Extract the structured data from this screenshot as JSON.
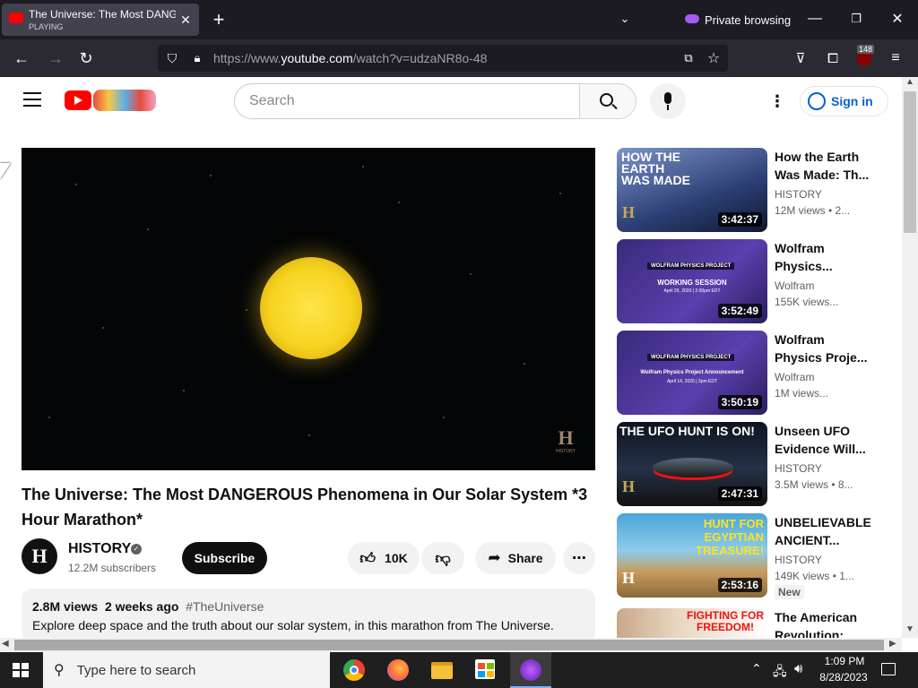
{
  "browser": {
    "tab_title": "The Universe: The Most DANGEROUS",
    "tab_status": "PLAYING",
    "private_label": "Private browsing",
    "url_prefix": "https://www.",
    "url_domain": "youtube.com",
    "url_path": "/watch?v=udzaNR8o-48",
    "extension_badge": "148"
  },
  "youtube": {
    "search_placeholder": "Search",
    "signin_label": "Sign in"
  },
  "video": {
    "title": "The Universe: The Most DANGEROUS Phenomena in Our Solar System *3 Hour Marathon*",
    "watermark": "HISTORY",
    "channel_name": "HISTORY",
    "subscribers": "12.2M subscribers",
    "subscribe_label": "Subscribe",
    "likes": "10K",
    "share_label": "Share",
    "views": "2.8M views",
    "age": "2 weeks ago",
    "hashtag": "#TheUniverse",
    "description": "Explore deep space and the truth about our solar system, in this marathon from The Universe."
  },
  "recommended": [
    {
      "title": "How the Earth Was Made: Th...",
      "channel": "HISTORY",
      "meta": "12M views • 2...",
      "duration": "3:42:37",
      "thumb_text": "HOW THE EARTH WAS MADE"
    },
    {
      "title": "Wolfram Physics...",
      "channel": "Wolfram",
      "meta": "155K views...",
      "duration": "3:52:49",
      "thumb_text": "WOLFRAM PHYSICS PROJECT",
      "thumb_sub": "WORKING SESSION",
      "thumb_date": "April 29, 2020 | 2:00pm EDT"
    },
    {
      "title": "Wolfram Physics Proje...",
      "channel": "Wolfram",
      "meta": "1M views...",
      "duration": "3:50:19",
      "thumb_text": "WOLFRAM PHYSICS PROJECT",
      "thumb_sub": "Wolfram Physics Project Announcement",
      "thumb_date": "April 14, 2020 | 2pm EDT"
    },
    {
      "title": "Unseen UFO Evidence Will...",
      "channel": "HISTORY",
      "meta": "3.5M views • 8...",
      "duration": "2:47:31",
      "thumb_text": "THE UFO HUNT IS ON!"
    },
    {
      "title": "UNBELIEVABLE ANCIENT...",
      "channel": "HISTORY",
      "meta": "149K views • 1...",
      "duration": "2:53:16",
      "thumb_text": "HUNT FOR EGYPTIAN TREASURE!",
      "badge": "New"
    },
    {
      "title": "The American Revolution:",
      "thumb_text": "FIGHTING FOR FREEDOM!"
    }
  ],
  "taskbar": {
    "search_placeholder": "Type here to search",
    "time": "1:09 PM",
    "date": "8/28/2023"
  }
}
